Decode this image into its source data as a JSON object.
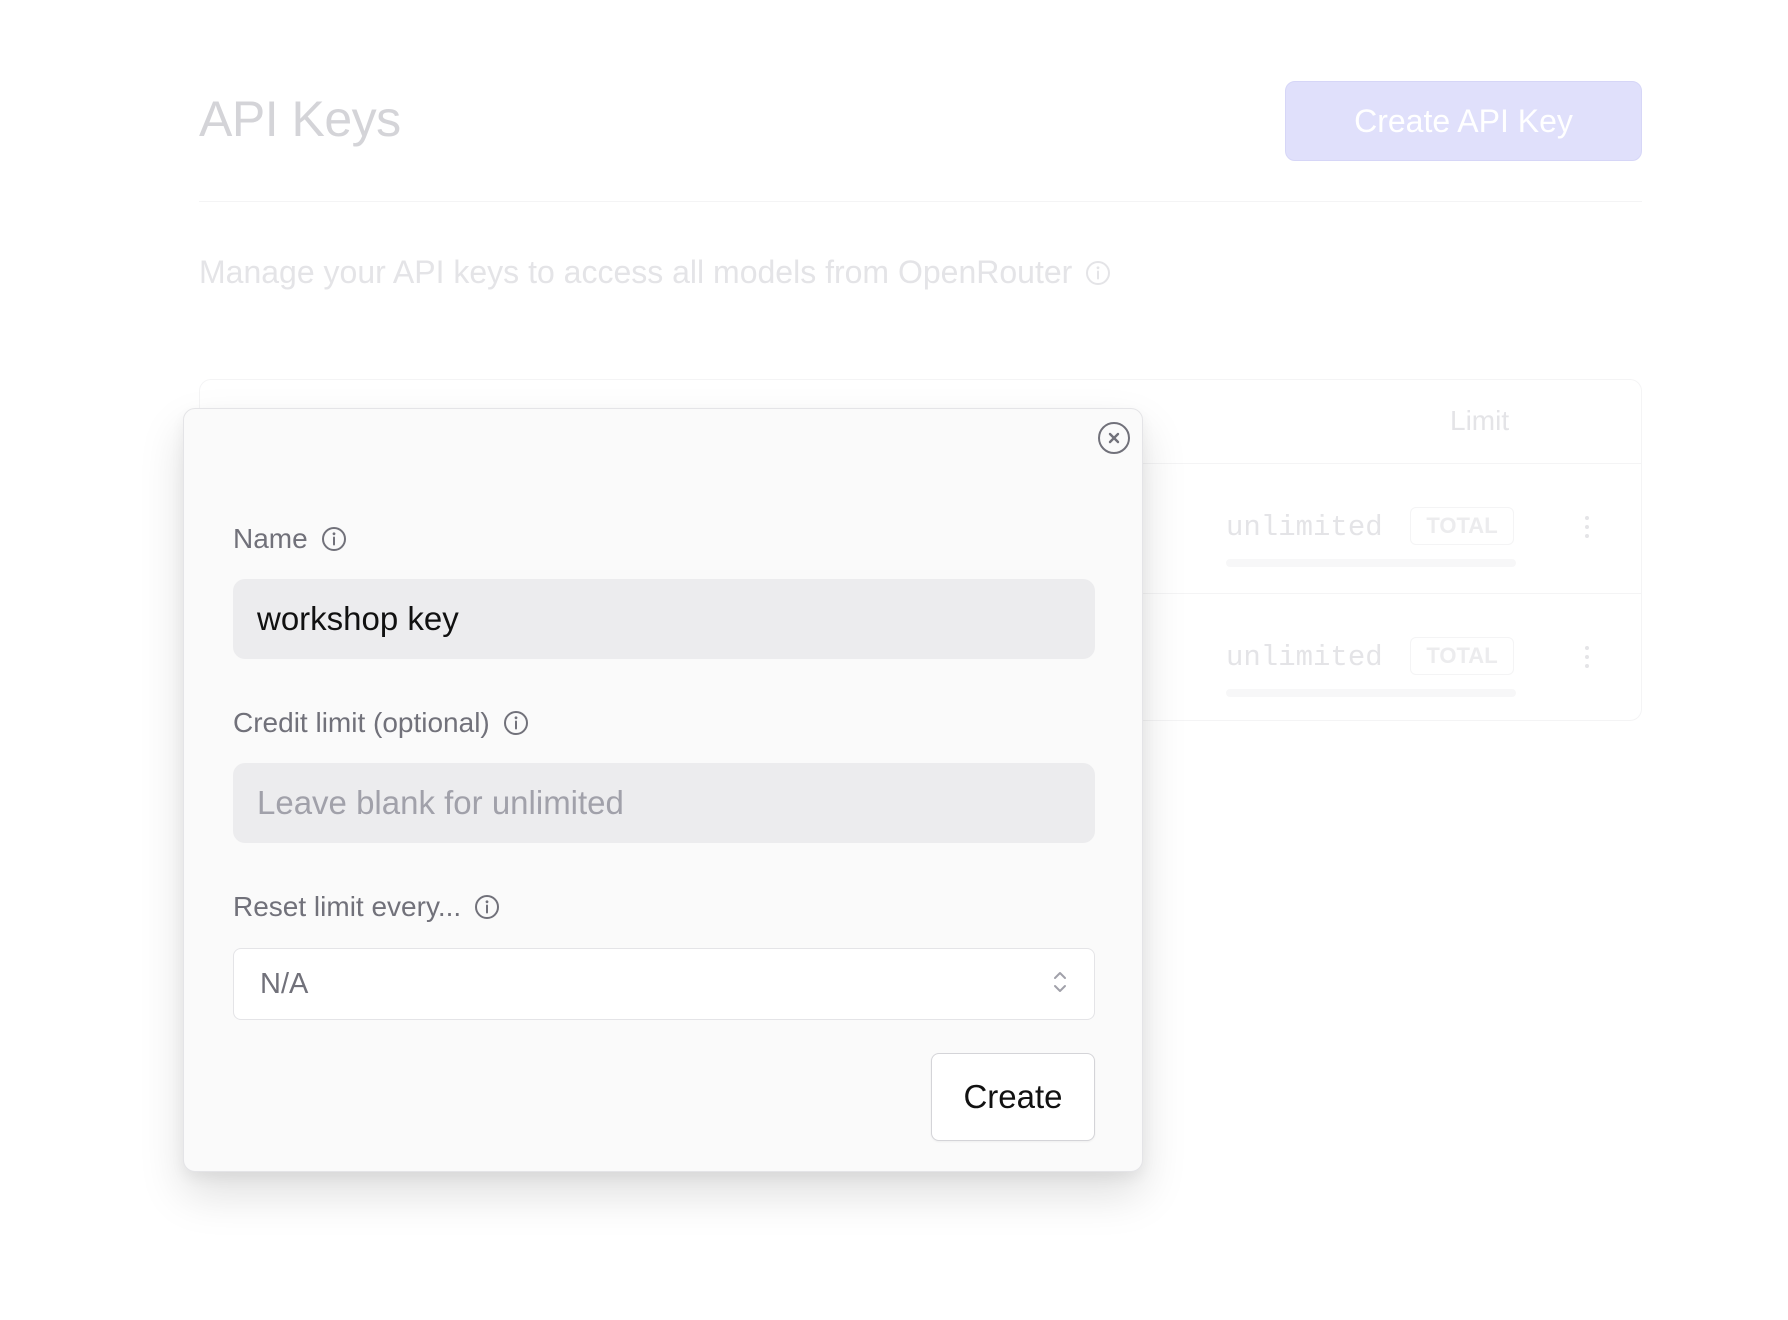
{
  "page": {
    "title": "API Keys",
    "create_button_label": "Create API Key",
    "subtitle": "Manage your API keys to access all models from OpenRouter"
  },
  "keys_table": {
    "limit_header": "Limit",
    "rows": [
      {
        "limit": "unlimited",
        "limit_type": "TOTAL"
      },
      {
        "limit": "unlimited",
        "limit_type": "TOTAL"
      }
    ]
  },
  "modal": {
    "name_label": "Name",
    "name_value": "workshop key",
    "credit_limit_label": "Credit limit (optional)",
    "credit_limit_placeholder": "Leave blank for unlimited",
    "credit_limit_value": "",
    "reset_label": "Reset limit every...",
    "reset_value": "N/A",
    "create_label": "Create"
  },
  "icons": {
    "info": "info-circle-icon",
    "close": "close-circle-icon",
    "select_arrows": "chevron-up-down-icon",
    "row_menu": "vertical-dots-icon"
  },
  "colors": {
    "accent_dimmed": "#e0e0fb",
    "modal_background": "#fafafa",
    "input_background": "#ececee",
    "label_text": "#71717a"
  }
}
